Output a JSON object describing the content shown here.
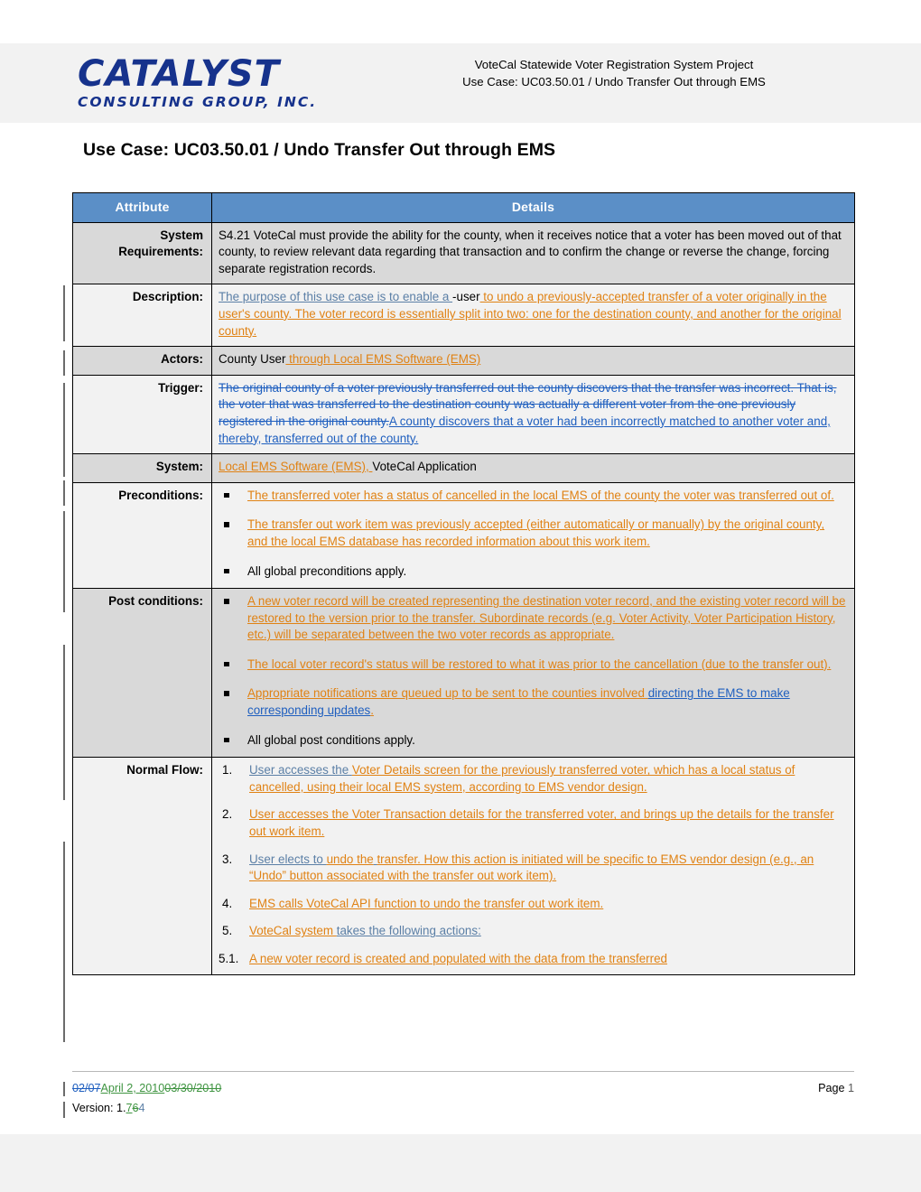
{
  "header": {
    "logo_main": "CATALYST",
    "logo_sub": "CONSULTING GROUP, INC.",
    "project_line": "VoteCal Statewide Voter Registration System Project",
    "usecase_line": "Use Case: UC03.50.01 / Undo Transfer Out through EMS"
  },
  "title": "Use Case: UC03.50.01 / Undo Transfer Out through EMS",
  "table": {
    "columns": [
      "Attribute",
      "Details"
    ],
    "rows": {
      "system_requirements": {
        "label": "System Requirements:",
        "text": "S4.21 VoteCal must provide the ability for the county, when it receives notice that a voter has been moved out of that county, to review relevant data regarding that transaction and to confirm the change or reverse the change, forcing separate registration records."
      },
      "description": {
        "label": "Description:",
        "ins_slate": "The purpose of this use case is to enable a ",
        "del_plain": "-user",
        "ins_orange": " to undo a previously-accepted transfer of a voter originally in the user's county.  The voter record is essentially split into two: one for the destination county, and another for the original county."
      },
      "actors": {
        "label": "Actors:",
        "plain": "County User",
        "ins_orange": " through Local EMS Software (EMS)"
      },
      "trigger": {
        "label": "Trigger:",
        "del_blue": "The original county of a voter previously transferred out the county discovers that the transfer was incorrect.  That is, the voter that was transferred to the destination county was actually a different voter from the one previously registered in the original county.",
        "ins_blue": "A county discovers that a voter had been incorrectly matched to another voter and, thereby, transferred out of the county."
      },
      "system": {
        "label": "System:",
        "ins_orange": "Local EMS Software (EMS), ",
        "plain": "VoteCal Application"
      },
      "preconditions": {
        "label": "Preconditions:",
        "items": [
          {
            "style": "ins_orange",
            "text": "The transferred voter has a status of cancelled in the local EMS of the county the voter was transferred out of."
          },
          {
            "style": "ins_orange",
            "text": "The transfer out work item was previously accepted (either automatically or manually) by the original county, and the local EMS database has recorded information about this work item."
          },
          {
            "style": "plain",
            "text": "All global preconditions apply."
          }
        ]
      },
      "post_conditions": {
        "label": "Post conditions:",
        "items": [
          {
            "style": "ins_orange",
            "text": "A new voter record will be created representing the destination voter record, and the existing voter record will be restored to the version prior to the transfer.  Subordinate records (e.g. Voter Activity, Voter Participation History, etc.) will be separated between the two voter records as appropriate."
          },
          {
            "style": "ins_orange",
            "text": "The local voter record's status will be restored to what it was prior to the cancellation (due to the transfer out)."
          },
          {
            "style": "mixed",
            "orange_a": "Appropriate notifications are queued up to be sent to the counties involved ",
            "blue": "directing the EMS to make corresponding updates",
            "orange_b": "."
          },
          {
            "style": "plain",
            "text": "All global post conditions apply."
          }
        ]
      },
      "normal_flow": {
        "label": "Normal Flow:",
        "items": [
          {
            "num": "1.",
            "slate": "User accesses the ",
            "orange": "Voter Details screen for the previously transferred voter, which has a local status of cancelled, using their local EMS system, according to EMS vendor design."
          },
          {
            "num": "2.",
            "slate": "",
            "orange": "User accesses the Voter Transaction details for the transferred voter, and brings up the details for the transfer out work item."
          },
          {
            "num": "3.",
            "slate": "User elects to ",
            "orange_mid": "undo the",
            "slate_mid": " ",
            "orange": "transfer. How this action is initiated will be specific to EMS vendor design (e.g., an “Undo” button associated with the transfer out work item)."
          },
          {
            "num": "4.",
            "slate": "",
            "orange": "EMS calls VoteCal API function to undo the transfer out work item."
          },
          {
            "num": "5.",
            "orange_lead": "VoteCal system ",
            "slate_tail": "takes the following actions:"
          }
        ],
        "sub_item": {
          "num": "5.1.",
          "orange": "A new voter record is created and populated with the data from the transferred"
        }
      }
    }
  },
  "footer": {
    "date_del_blue": "02/07",
    "date_ins_green": "April 2, 2010",
    "date_del_green": "03/30/2010",
    "version_label": "Version: 1.",
    "version_ins_green": "7",
    "version_del_green": "6",
    "version_tail": "4",
    "page_label": "Page ",
    "page_number": "1"
  }
}
